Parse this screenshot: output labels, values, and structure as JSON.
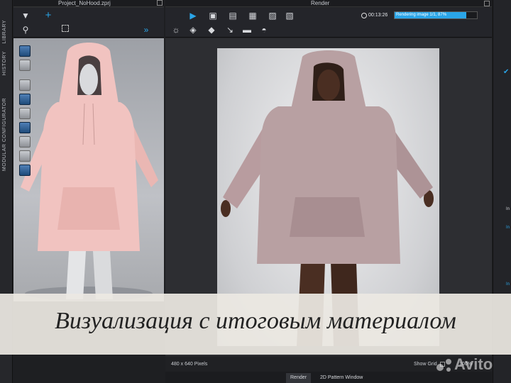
{
  "side_tabs": {
    "library": "LIBRARY",
    "history": "HISTORY",
    "modular": "MODULAR CONFIGURATOR"
  },
  "window_3d": {
    "title": "Project_NoHood.zprj",
    "toolbar_icons": [
      "select-arrow-icon",
      "move-icon",
      "box-select-icon",
      "walk-icon",
      "expand-icon"
    ]
  },
  "render_window": {
    "title": "Render",
    "timer": "00:13:26",
    "progress_label": "Rendering image 1/1, 87%",
    "progress_value": 0.87,
    "image_size": "480 x 640 Pixels",
    "show_grid_label": "Show Grid",
    "zoom": "100%",
    "toolbar_icons": [
      "render-play-icon",
      "render-video-icon",
      "camera-icon",
      "image-icon",
      "photo-icon",
      "environment-icon",
      "light-icon",
      "spot-light-icon",
      "directional-light-icon",
      "plane-icon",
      "sphere-icon"
    ]
  },
  "bottom_tabs": [
    "Render",
    "2D Pattern Window"
  ],
  "right_panel": {
    "label_in1": "In",
    "label_in2": "In",
    "label_in3": "In"
  },
  "caption": "Визуализация с итоговым материалом",
  "watermark": "Avito",
  "colors": {
    "accent": "#2aa5e8",
    "hoodie_3d": "#f1c3c0",
    "hoodie_render": "#b8a0a2",
    "banner": "#ece8e2"
  }
}
